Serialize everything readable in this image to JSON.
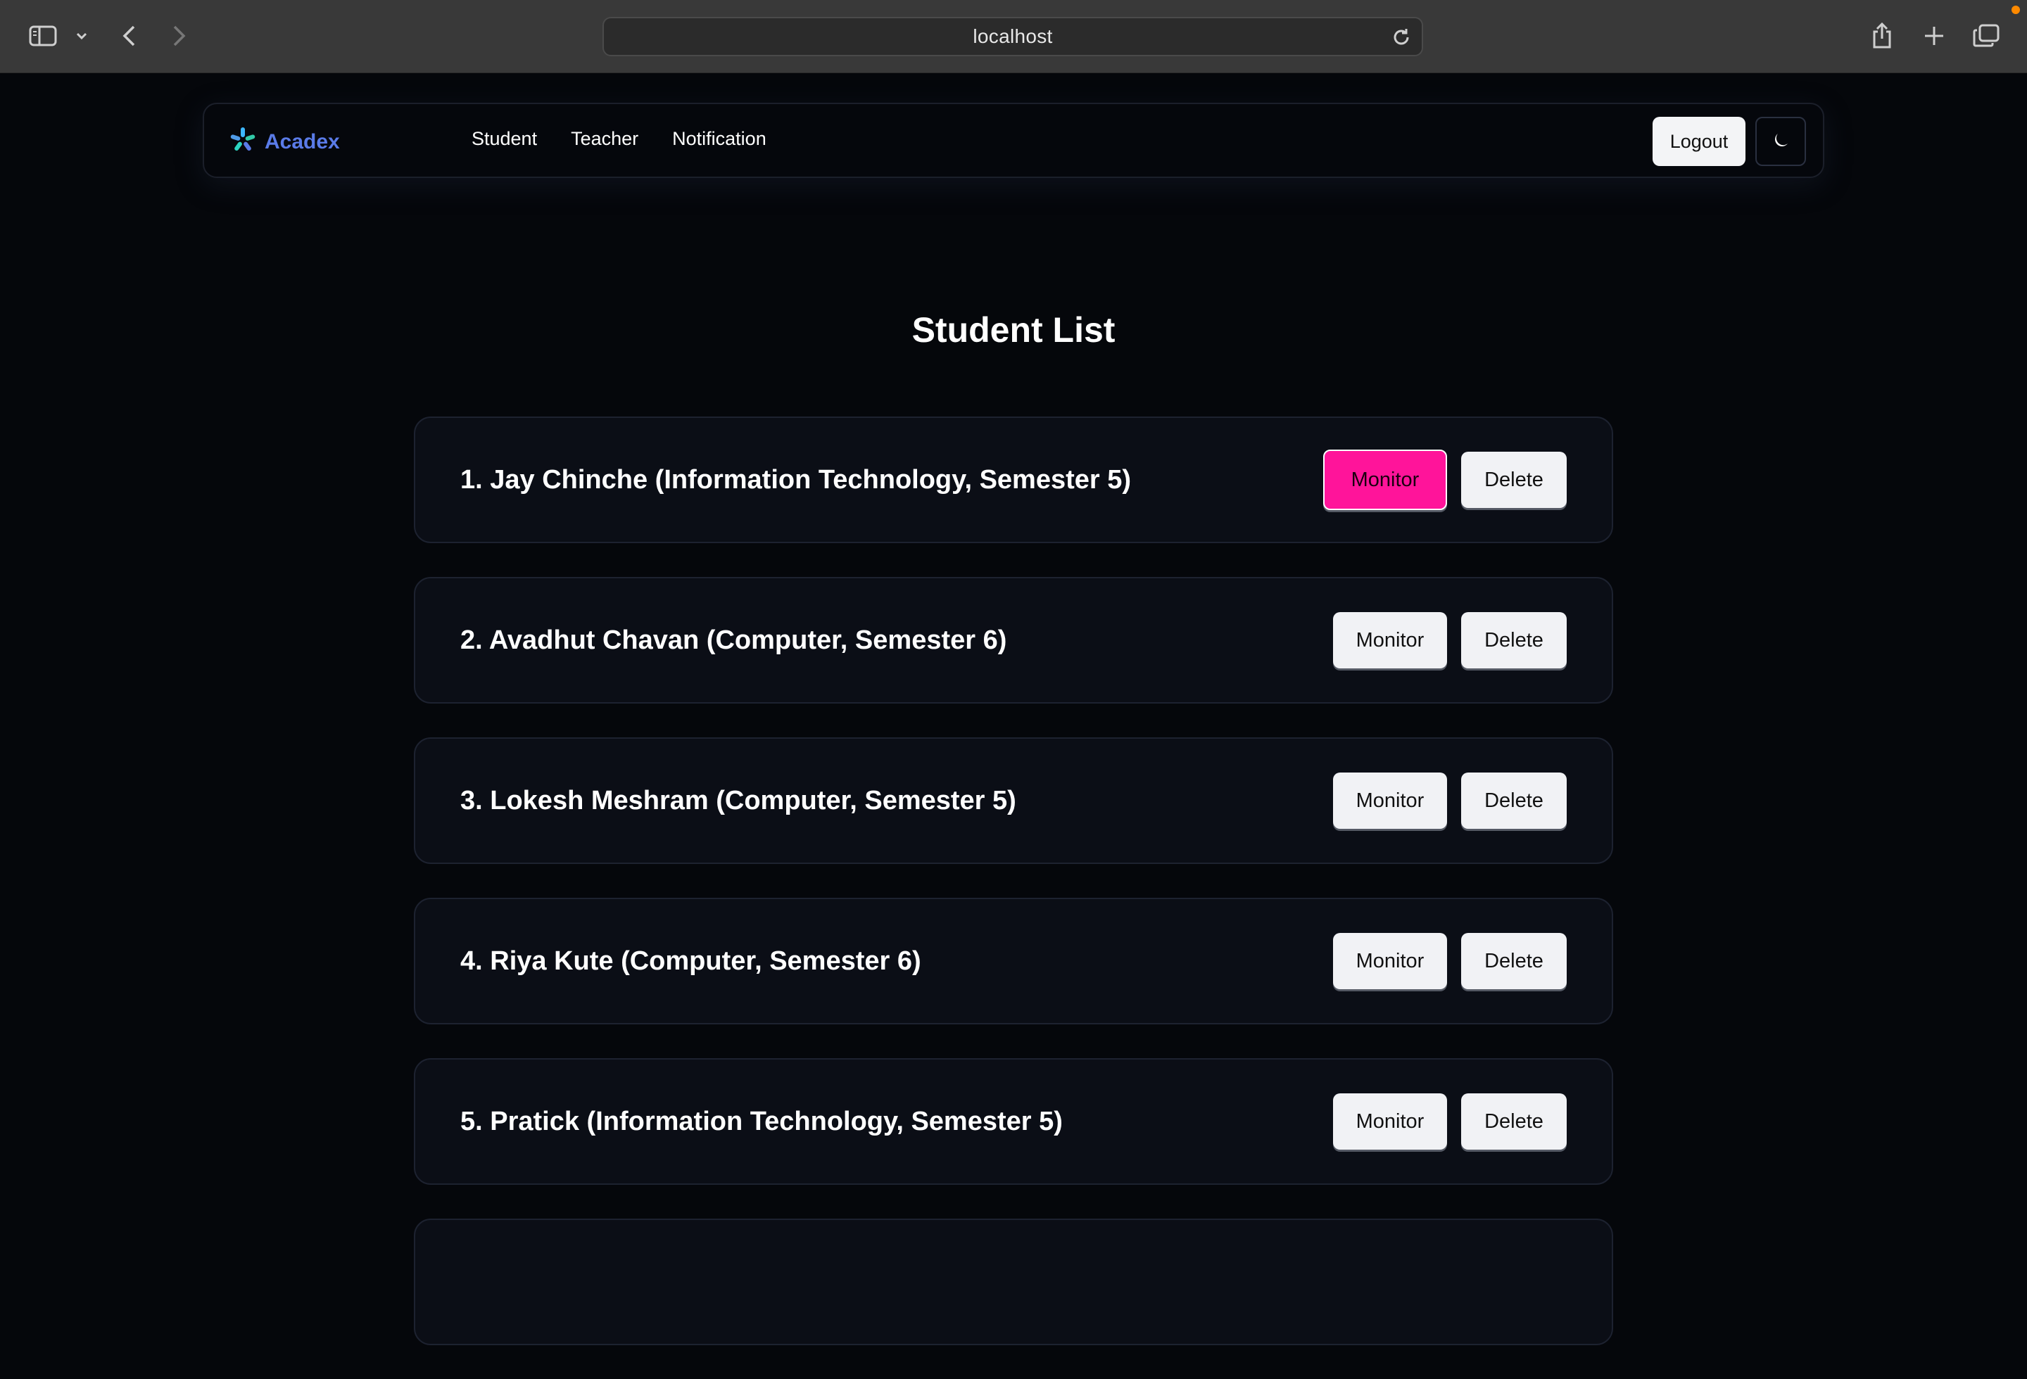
{
  "browser": {
    "url": "localhost"
  },
  "nav": {
    "brand": "Acadex",
    "links": [
      "Student",
      "Teacher",
      "Notification"
    ],
    "logout_label": "Logout"
  },
  "page": {
    "title": "Student List"
  },
  "students": [
    {
      "label": "1. Jay Chinche (Information Technology, Semester 5)",
      "monitor": "Monitor",
      "delete": "Delete"
    },
    {
      "label": "2. Avadhut Chavan (Computer, Semester 6)",
      "monitor": "Monitor",
      "delete": "Delete"
    },
    {
      "label": "3. Lokesh Meshram (Computer, Semester 5)",
      "monitor": "Monitor",
      "delete": "Delete"
    },
    {
      "label": "4. Riya Kute (Computer, Semester 6)",
      "monitor": "Monitor",
      "delete": "Delete"
    },
    {
      "label": "5. Pratick (Information Technology, Semester 5)",
      "monitor": "Monitor",
      "delete": "Delete"
    }
  ],
  "colors": {
    "accent_pink": "#ff149a",
    "brand_blue": "#5a7be8",
    "background": "#05070b"
  }
}
